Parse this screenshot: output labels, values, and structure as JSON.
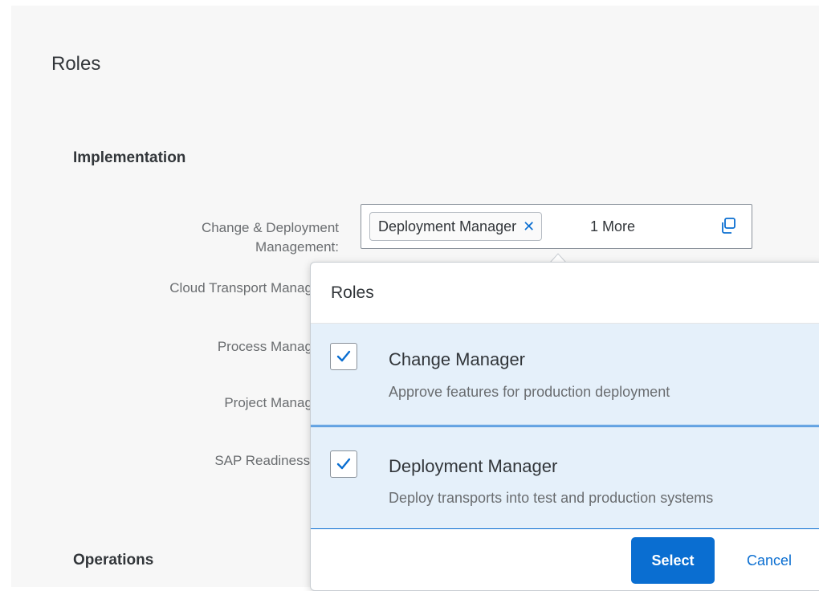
{
  "page": {
    "title": "Roles"
  },
  "sections": [
    {
      "title": "Implementation"
    },
    {
      "title": "Operations"
    }
  ],
  "fields": {
    "change_deployment": {
      "label_line1": "Change & Deployment",
      "label_line2": "Management:",
      "token_label": "Deployment Manager",
      "more_text": "1 More"
    },
    "cloud_transport": {
      "label": "Cloud Transport Manageme"
    },
    "process": {
      "label": "Process Manageme"
    },
    "project": {
      "label": "Project Manageme"
    },
    "readiness": {
      "label": "SAP Readiness Che"
    }
  },
  "popover": {
    "title": "Roles",
    "items": [
      {
        "title": "Change Manager",
        "description": "Approve features for production deployment",
        "checked": true
      },
      {
        "title": "Deployment Manager",
        "description": "Deploy transports into test and production systems",
        "checked": true
      }
    ],
    "select_label": "Select",
    "cancel_label": "Cancel"
  },
  "icons": {
    "token_close": "close-icon",
    "value_help": "value-help-icon",
    "checkbox": "checkmark-icon"
  },
  "colors": {
    "accent": "#0a6ed1",
    "selected_bg": "#e5f0fa",
    "page_bg": "#f7f7f7"
  }
}
